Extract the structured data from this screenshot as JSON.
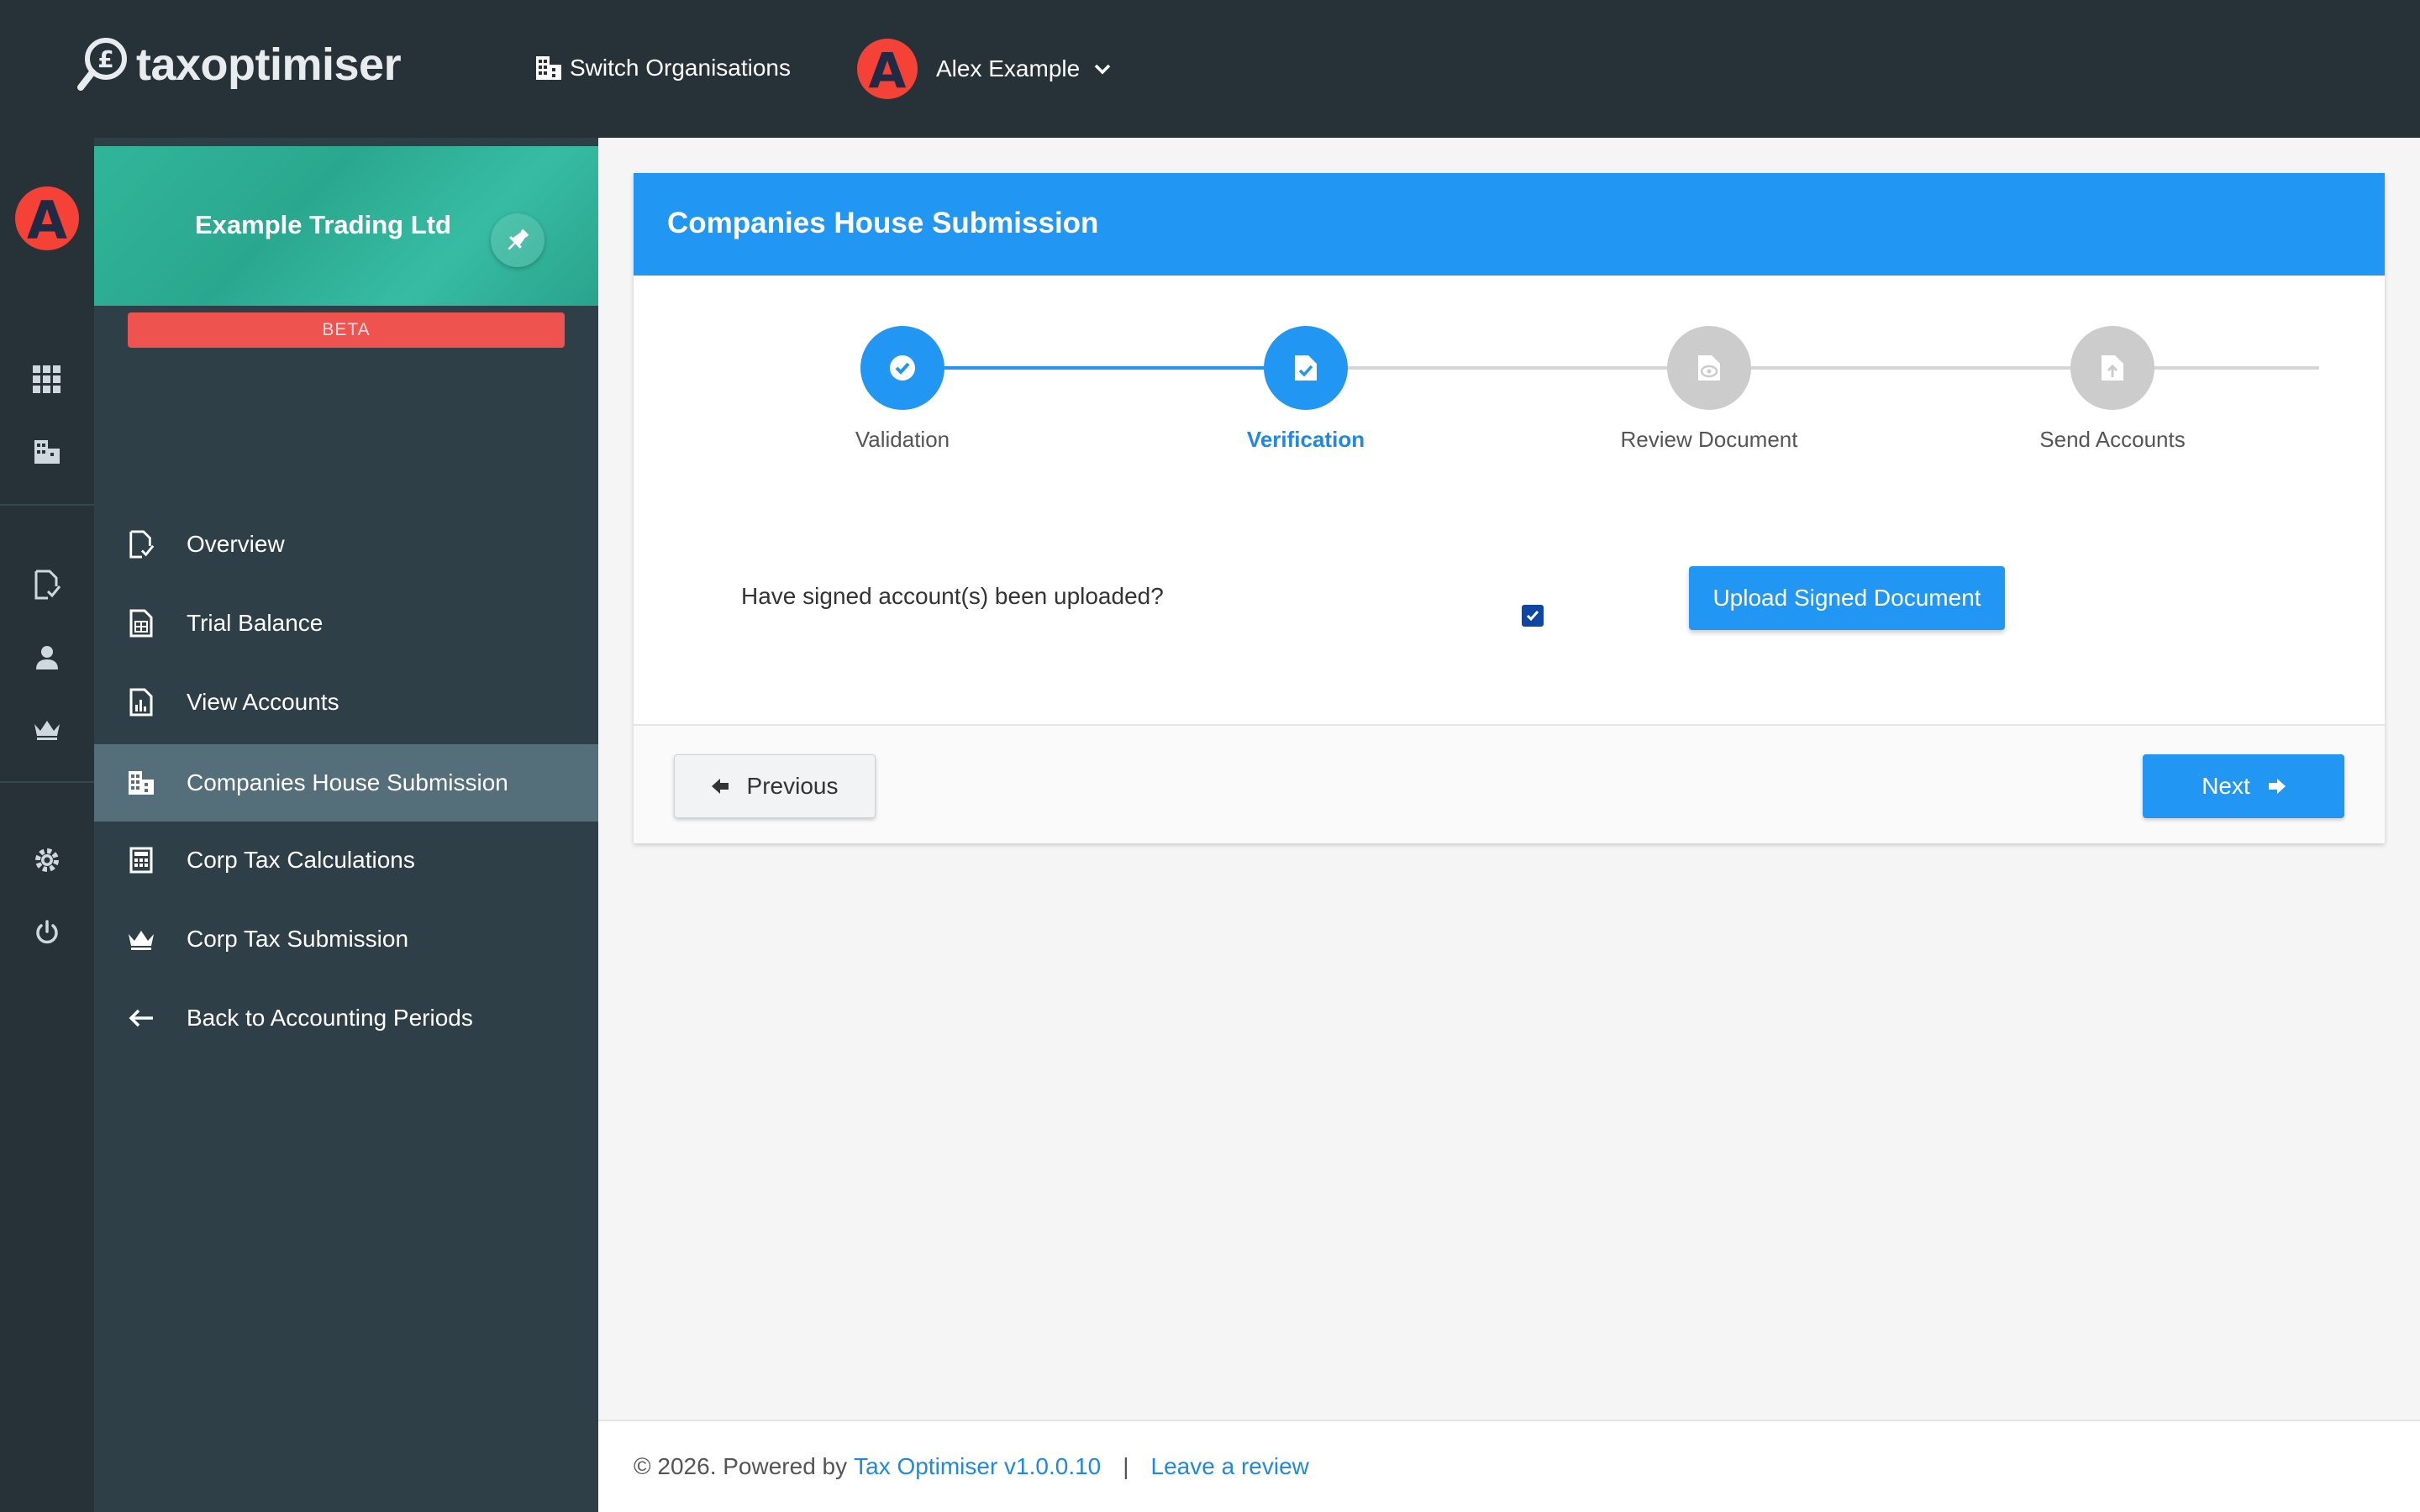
{
  "app": {
    "logo_text": "taxoptimiser",
    "switch_org_label": "Switch Organisations",
    "user_initial": "A",
    "user_name": "Alex Example"
  },
  "sidebar": {
    "org_name": "Example Trading Ltd",
    "beta_label": "BETA",
    "items": [
      {
        "label": "Overview",
        "icon": "document-check-icon"
      },
      {
        "label": "Trial Balance",
        "icon": "spreadsheet-icon"
      },
      {
        "label": "View Accounts",
        "icon": "report-chart-icon"
      },
      {
        "label": "Companies House Submission",
        "icon": "building-icon",
        "active": true
      },
      {
        "label": "Corp Tax Calculations",
        "icon": "calculator-icon"
      },
      {
        "label": "Corp Tax Submission",
        "icon": "crown-icon"
      },
      {
        "label": "Back to Accounting Periods",
        "icon": "arrow-left-icon"
      }
    ]
  },
  "main": {
    "title": "Companies House Submission",
    "steps": [
      {
        "label": "Validation",
        "state": "complete"
      },
      {
        "label": "Verification",
        "state": "active"
      },
      {
        "label": "Review Document",
        "state": "pending"
      },
      {
        "label": "Send Accounts",
        "state": "pending"
      }
    ],
    "question": "Have signed account(s) been uploaded?",
    "uploaded_checked": true,
    "upload_label": "Upload Signed Document",
    "prev_label": "Previous",
    "next_label": "Next"
  },
  "footer": {
    "copyright": "© 2026. Powered by",
    "product_link": "Tax Optimiser v1.0.0.10",
    "separator": "|",
    "review_link": "Leave a review"
  },
  "colors": {
    "topbar": "#263238",
    "sidebar": "#2f3f48",
    "accent": "#2196f3",
    "active_nav": "#546e7a",
    "org_banner": "#31b59a",
    "beta": "#ef5350",
    "avatar": "#f44336"
  }
}
